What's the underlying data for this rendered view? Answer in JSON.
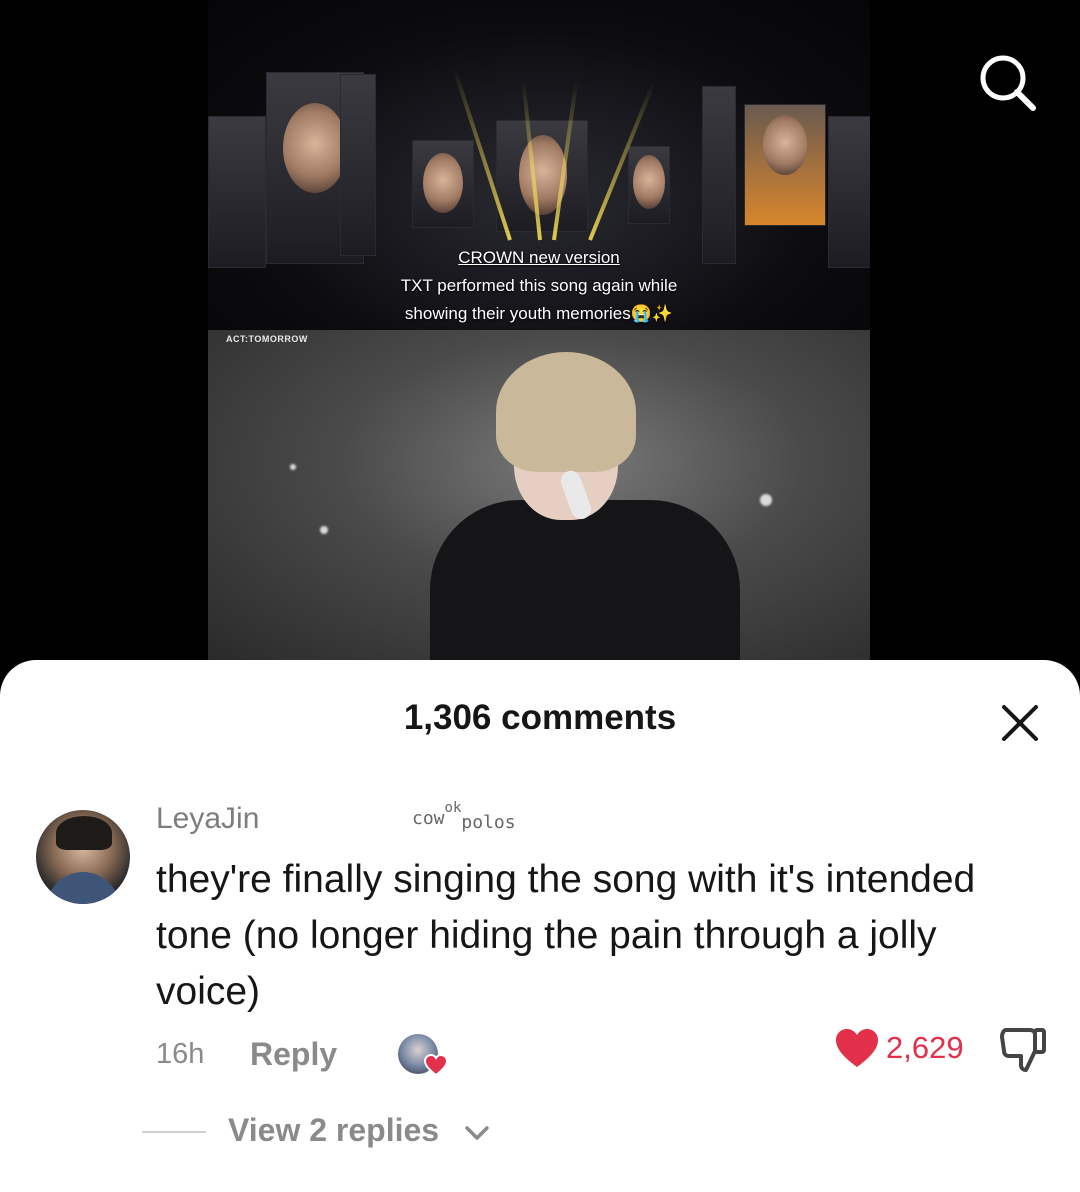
{
  "video": {
    "caption_line1": "CROWN new version",
    "caption_line2": "TXT performed this song again while",
    "caption_line3": "showing their youth memories😭✨",
    "brand_text": "ACT:TOMORROW"
  },
  "comments_panel": {
    "count_title": "1,306 comments"
  },
  "comment": {
    "username": "LeyaJin",
    "decor_text_a": "cow",
    "decor_text_b": "ok",
    "decor_text_c": "polos",
    "text": "they're finally singing the song with it's intended tone (no longer hiding the pain through a jolly voice)",
    "time": "16h",
    "reply_label": "Reply",
    "like_count": "2,629",
    "view_replies_label": "View 2 replies"
  },
  "colors": {
    "accent_red": "#e2304b",
    "muted_text": "#8a8a8a",
    "primary_text": "#161616"
  },
  "icons": {
    "search": "search-icon",
    "close": "close-icon",
    "like": "heart-icon",
    "dislike": "thumbs-down-icon",
    "expand": "chevron-down-icon"
  }
}
